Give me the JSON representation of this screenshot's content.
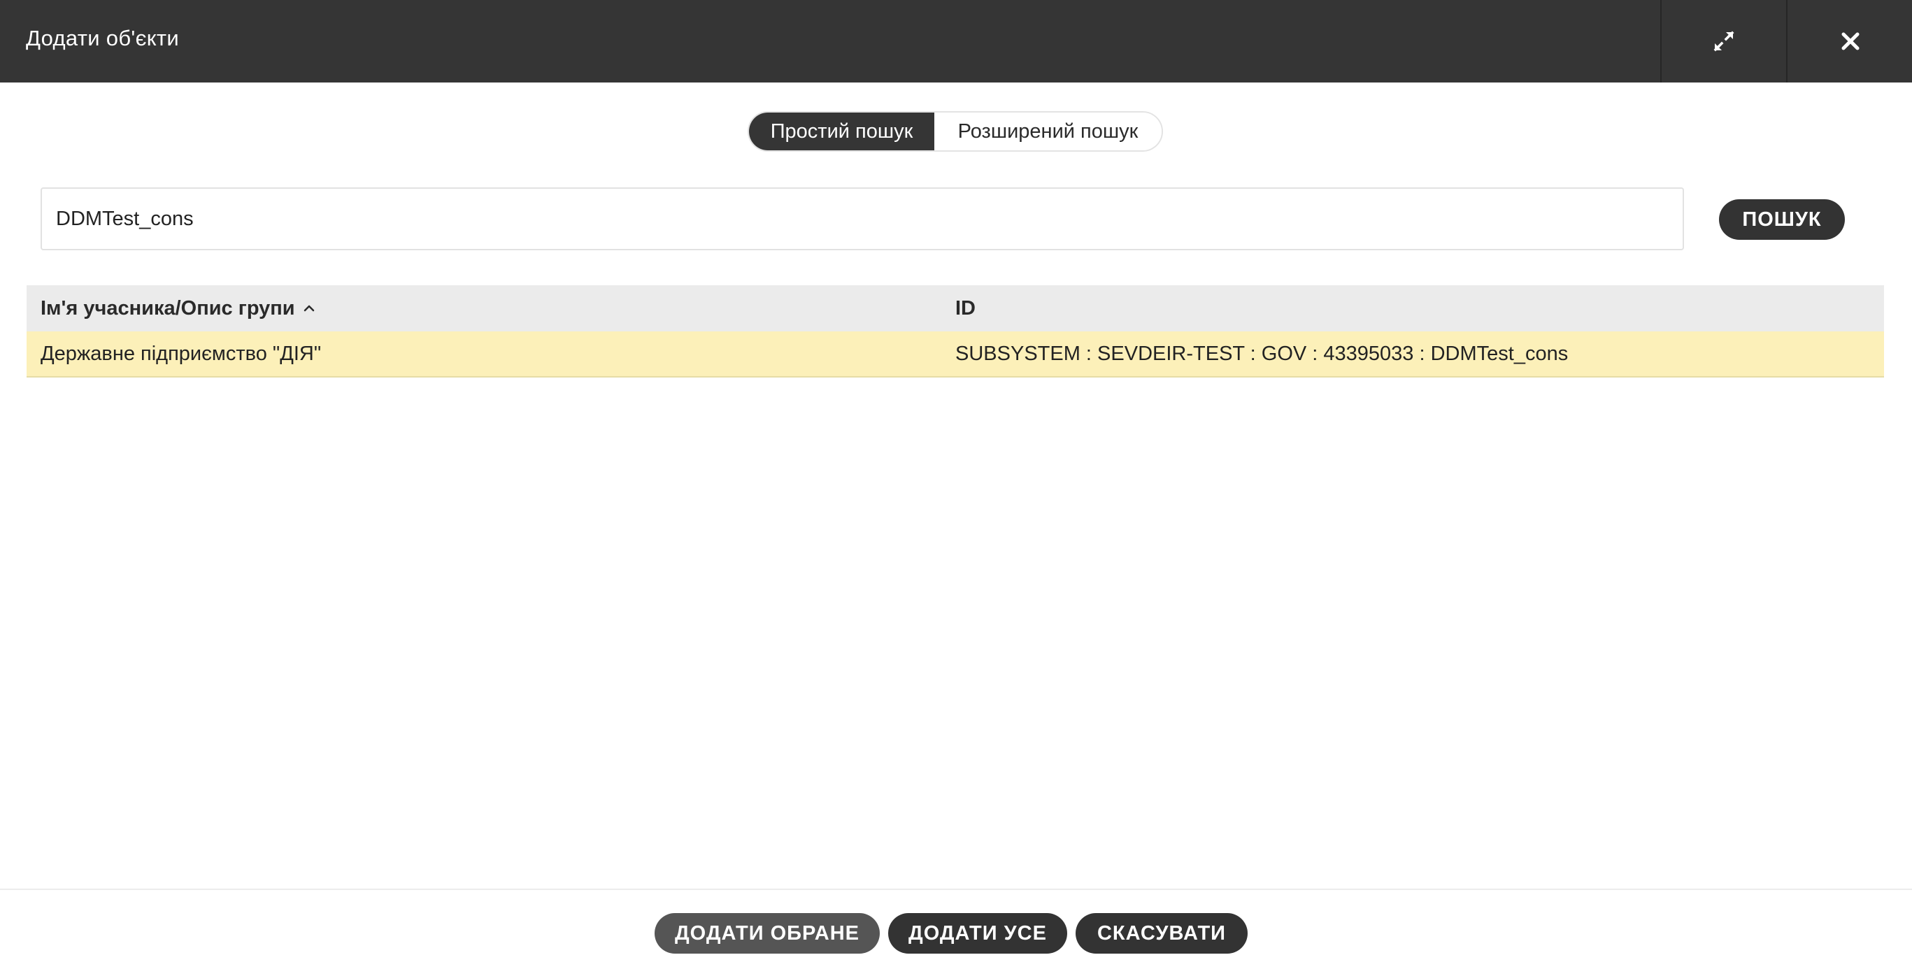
{
  "window": {
    "title": "Додати об'єкти",
    "expand_icon": "expand-icon",
    "close_icon": "close-icon"
  },
  "search_mode": {
    "simple": "Простий пошук",
    "advanced": "Розширений пошук",
    "selected": "simple"
  },
  "search": {
    "value": "DDMTest_cons",
    "button_label": "ПОШУК"
  },
  "table": {
    "columns": {
      "name": "Ім'я учасника/Опис групи",
      "id": "ID"
    },
    "sort_icon": "chevron-up-icon",
    "rows": [
      {
        "name": "Державне підприємство \"ДІЯ\"",
        "id": "SUBSYSTEM : SEVDEIR-TEST : GOV : 43395033 : DDMTest_cons",
        "highlighted": true
      }
    ]
  },
  "footer": {
    "add_selected": "ДОДАТИ ОБРАНЕ",
    "add_all": "ДОДАТИ УСЕ",
    "cancel": "СКАСУВАТИ"
  },
  "colors": {
    "titlebar": "#353535",
    "row_highlight": "#fcf0b9",
    "header_bg": "#ebebeb",
    "button_dark": "#333333",
    "button_disabled": "#555555"
  }
}
